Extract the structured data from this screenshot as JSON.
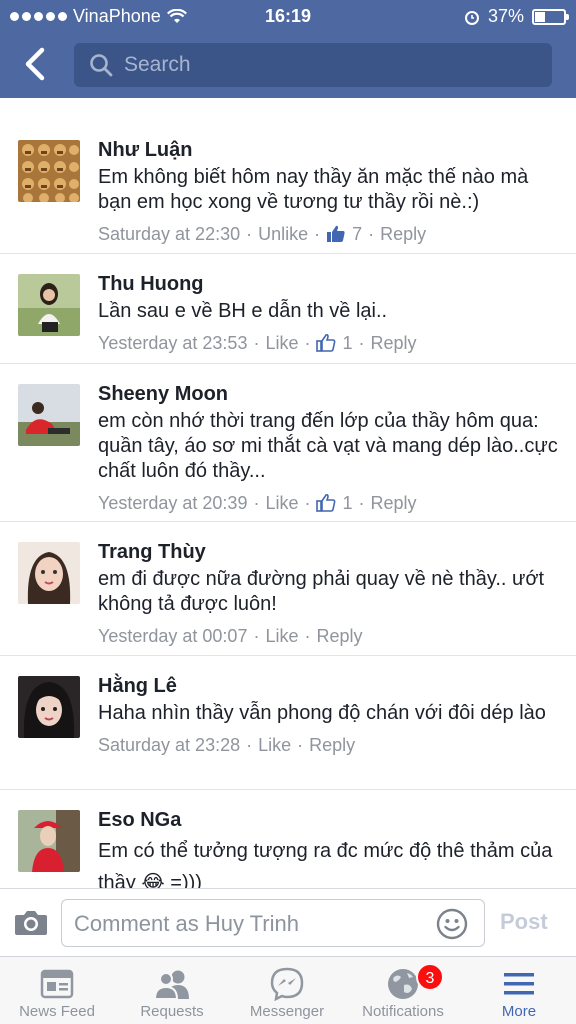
{
  "status_bar": {
    "carrier": "VinaPhone",
    "time": "16:19",
    "battery": "37%",
    "battery_level": 0.37
  },
  "nav": {
    "search_placeholder": "Search"
  },
  "comments": [
    {
      "name": "Như Luận",
      "text": "Em không biết hôm nay thầy ăn mặc thế nào mà bạn em học xong về tương tư thầy rồi nè.:)",
      "time": "Saturday at 22:30",
      "action": "Unlike",
      "likes": "7",
      "liked": true,
      "reply": "Reply"
    },
    {
      "name": "Thu Huong",
      "text": "Lần sau e về BH e dẫn th về lại..",
      "time": "Yesterday at 23:53",
      "action": "Like",
      "likes": "1",
      "liked": false,
      "reply": "Reply"
    },
    {
      "name": "Sheeny Moon",
      "text": "em còn nhớ thời trang đến lớp của thầy hôm qua: quần tây, áo sơ mi thắt cà vạt và mang dép lào..cực chất luôn đó thầy...",
      "time": "Yesterday at 20:39",
      "action": "Like",
      "likes": "1",
      "liked": false,
      "reply": "Reply"
    },
    {
      "name": "Trang Thùy",
      "text": "em đi được nữa đường phải quay về nè thầy.. ướt không tả được luôn!",
      "time": "Yesterday at 00:07",
      "action": "Like",
      "likes": "",
      "liked": false,
      "reply": "Reply"
    },
    {
      "name": "Hằng Lê",
      "text": "Haha nhìn thầy vẫn phong độ chán với đôi dép lào",
      "time": "Saturday at 23:28",
      "action": "Like",
      "likes": "",
      "liked": false,
      "reply": "Reply"
    },
    {
      "name": "Eso NGa",
      "text": "Em có thể tưởng tượng ra đc mức độ thê thảm của thầy 😂 =)))",
      "time": "",
      "action": "",
      "likes": "",
      "liked": false,
      "reply": ""
    }
  ],
  "composer": {
    "placeholder": "Comment as Huy Trinh",
    "post_label": "Post"
  },
  "tabbar": {
    "tabs": [
      {
        "label": "News Feed",
        "icon": "news-feed-icon"
      },
      {
        "label": "Requests",
        "icon": "friend-requests-icon"
      },
      {
        "label": "Messenger",
        "icon": "messenger-icon"
      },
      {
        "label": "Notifications",
        "icon": "globe-icon",
        "badge": "3"
      },
      {
        "label": "More",
        "icon": "menu-icon",
        "active": true
      }
    ]
  },
  "colors": {
    "brand": "#4e69a2",
    "link": "#4267b2",
    "badge": "#fa0f0f"
  }
}
